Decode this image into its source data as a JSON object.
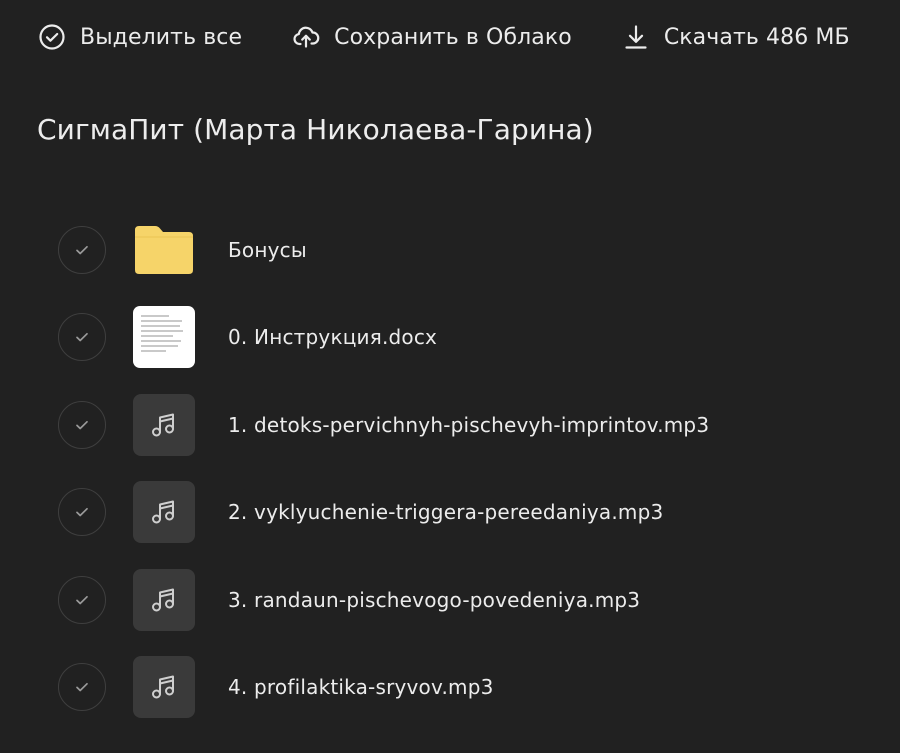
{
  "toolbar": {
    "select_all_label": "Выделить все",
    "save_cloud_label": "Сохранить в Облако",
    "download_label": "Скачать 486 МБ"
  },
  "folder": {
    "title": "СигмаПит (Марта Николаева-Гарина)"
  },
  "files": [
    {
      "name": "Бонусы",
      "type": "folder",
      "icon": "folder-icon"
    },
    {
      "name": "0. Инструкция.docx",
      "type": "docx",
      "icon": "document-thumbnail"
    },
    {
      "name": "1. detoks-pervichnyh-pischevyh-imprintov.mp3",
      "type": "mp3",
      "icon": "music-note-icon"
    },
    {
      "name": "2. vyklyuchenie-triggera-pereedaniya.mp3",
      "type": "mp3",
      "icon": "music-note-icon"
    },
    {
      "name": "3. randaun-pischevogo-povedeniya.mp3",
      "type": "mp3",
      "icon": "music-note-icon"
    },
    {
      "name": "4. profilaktika-sryvov.mp3",
      "type": "mp3",
      "icon": "music-note-icon"
    }
  ],
  "colors": {
    "background": "#212121",
    "text": "#ececec",
    "folder_yellow": "#f6d469",
    "audio_tile": "#3a3a3a",
    "check_border": "#3f3f3f"
  }
}
